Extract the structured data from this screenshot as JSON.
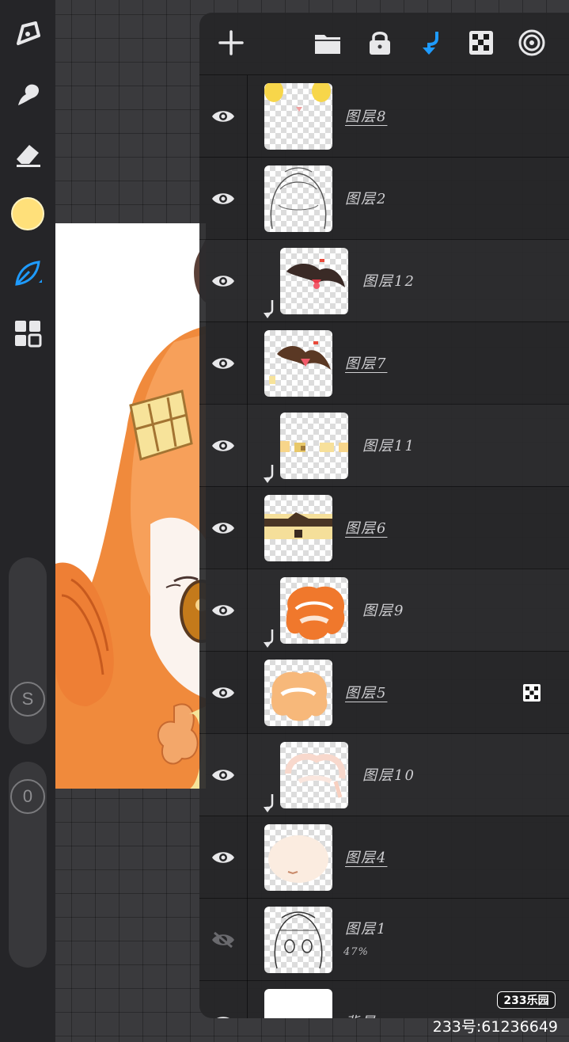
{
  "tools": {
    "items": [
      "brush-icon",
      "smudge-icon",
      "eraser-icon",
      "color-swatch",
      "leaf-brush-icon",
      "gallery-icon"
    ],
    "current_color": "#ffe07a",
    "active_accent": "#1e9bff"
  },
  "sliders": {
    "size_label": "S",
    "opacity_label": "0"
  },
  "layers_panel": {
    "header_icons": [
      "add-icon",
      "folder-icon",
      "lock-icon",
      "clip-icon",
      "mask-icon",
      "target-icon"
    ],
    "layers": [
      {
        "name": "图层8",
        "visible": true,
        "clipped": false,
        "opacity": ""
      },
      {
        "name": "图层2",
        "visible": true,
        "clipped": false,
        "opacity": ""
      },
      {
        "name": "图层12",
        "visible": true,
        "clipped": true,
        "opacity": ""
      },
      {
        "name": "图层7",
        "visible": true,
        "clipped": false,
        "opacity": ""
      },
      {
        "name": "图层11",
        "visible": true,
        "clipped": true,
        "opacity": ""
      },
      {
        "name": "图层6",
        "visible": true,
        "clipped": false,
        "opacity": ""
      },
      {
        "name": "图层9",
        "visible": true,
        "clipped": true,
        "opacity": ""
      },
      {
        "name": "图层5",
        "visible": true,
        "clipped": false,
        "opacity": ""
      },
      {
        "name": "图层10",
        "visible": true,
        "clipped": true,
        "opacity": ""
      },
      {
        "name": "图层4",
        "visible": true,
        "clipped": false,
        "opacity": ""
      },
      {
        "name": "图层1",
        "visible": false,
        "clipped": false,
        "opacity": "47%"
      },
      {
        "name": "背景",
        "visible": true,
        "clipped": false,
        "opacity": ""
      }
    ]
  },
  "watermark": {
    "logo": "233乐园",
    "id_text": "233号:61236649"
  }
}
